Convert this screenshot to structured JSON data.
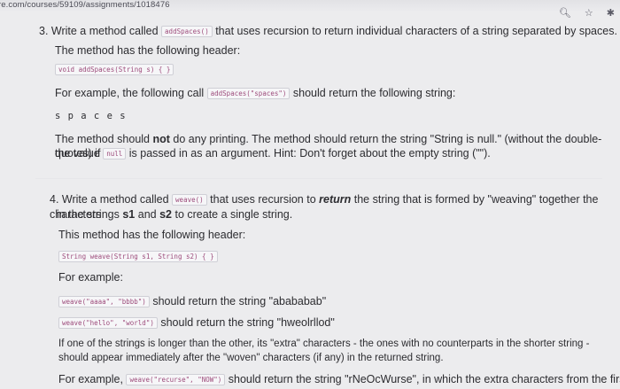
{
  "browser": {
    "url": "re.com/courses/59109/assignments/1018476"
  },
  "q3": {
    "intro_a": "3. Write a method called",
    "method_code": "addSpaces()",
    "intro_b": "that uses recursion to return individual characters of a string separated by spaces.",
    "header_text": "The method has the following header:",
    "header_code": "void addSpaces(String s) { }",
    "example_a": "For example, the following call",
    "example_code": "addSpaces(\"spaces\")",
    "example_b": "should return the following string:",
    "result": "s p a c e s",
    "note_a": "The method should",
    "note_not": "not",
    "note_b": "do any printing. The method should return the string \"String is null.\" (without the double-quotes) if",
    "note_c": "the value",
    "null_code": "null",
    "note_d": "is passed in as an argument. Hint: Don't forget about the empty string (\"\")."
  },
  "q4": {
    "intro_a": "4. Write a method called",
    "method_code": "weave()",
    "intro_b": "that uses recursion to",
    "intro_return": "return",
    "intro_c": "the string that is formed by \"weaving\" together the characters",
    "intro_d": "in the strings",
    "s1": "s1",
    "intro_and": "and",
    "s2": "s2",
    "intro_e": "to create a single string.",
    "header_text": "This method has the following header:",
    "header_code": "String weave(String s1, String s2) { }",
    "example_label": "For example:",
    "ex1_code": "weave(\"aaaa\", \"bbbb\")",
    "ex1_text": "should return the string \"abababab\"",
    "ex2_code": "weave(\"hello\", \"world\")",
    "ex2_text": "should return the string \"hweolrllod\"",
    "extra_a": "If one of the strings is longer than the other, its \"extra\" characters - the ones with no counterparts in the shorter string -",
    "extra_b": "should appear immediately after the \"woven\" characters (if any) in the returned string.",
    "ex3_a": "For example,",
    "ex3_code": "weave(\"recurse\", \"NOW\")",
    "ex3_b": "should return the string \"rNeOcWurse\", in which the extra characters from the first"
  }
}
